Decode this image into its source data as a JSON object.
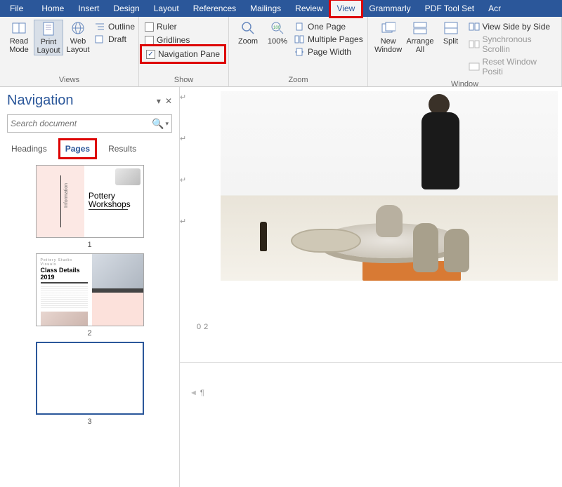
{
  "menubar": {
    "tabs": [
      "File",
      "Home",
      "Insert",
      "Design",
      "Layout",
      "References",
      "Mailings",
      "Review",
      "View",
      "Grammarly",
      "PDF Tool Set",
      "Acr"
    ],
    "active": "View"
  },
  "ribbon": {
    "views": {
      "read_mode": "Read\nMode",
      "print_layout": "Print\nLayout",
      "web_layout": "Web\nLayout",
      "outline": "Outline",
      "draft": "Draft",
      "group_label": "Views"
    },
    "show": {
      "ruler": "Ruler",
      "gridlines": "Gridlines",
      "navigation_pane": "Navigation Pane",
      "group_label": "Show"
    },
    "zoom": {
      "zoom": "Zoom",
      "hundred": "100%",
      "one_page": "One Page",
      "multiple_pages": "Multiple Pages",
      "page_width": "Page Width",
      "group_label": "Zoom"
    },
    "window": {
      "new_window": "New\nWindow",
      "arrange_all": "Arrange\nAll",
      "split": "Split",
      "side_by_side": "View Side by Side",
      "sync_scroll": "Synchronous Scrollin",
      "reset_pos": "Reset Window Positi",
      "group_label": "Window"
    }
  },
  "nav": {
    "title": "Navigation",
    "search_placeholder": "Search document",
    "tabs": {
      "headings": "Headings",
      "pages": "Pages",
      "results": "Results"
    },
    "thumbs": {
      "p1": {
        "num": "1",
        "title1": "Pottery",
        "title2": "Workshops",
        "side_text": "Information"
      },
      "p2": {
        "num": "2",
        "subtitle": "Pottery Studio Visuals",
        "title": "Class Details 2019"
      },
      "p3": {
        "num": "3"
      }
    }
  },
  "doc": {
    "page_number_label": "02"
  }
}
